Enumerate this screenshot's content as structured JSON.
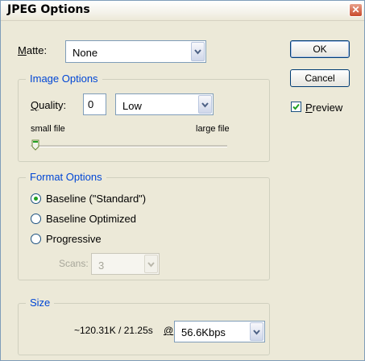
{
  "window": {
    "title": "JPEG Options"
  },
  "matte": {
    "label_prefix": "",
    "label_u": "M",
    "label_rest": "atte:",
    "value": "None"
  },
  "buttons": {
    "ok": "OK",
    "cancel": "Cancel"
  },
  "preview": {
    "checked": true,
    "label_u": "P",
    "label_rest": "review"
  },
  "image_options": {
    "legend": "Image Options",
    "quality_label_u": "Q",
    "quality_label_rest": "uality:",
    "quality_value": "0",
    "quality_preset": "Low",
    "small_file": "small file",
    "large_file": "large file",
    "slider_level": 0
  },
  "format_options": {
    "legend": "Format Options",
    "options": [
      {
        "label": "Baseline (\"Standard\")",
        "selected": true
      },
      {
        "label": "Baseline Optimized",
        "selected": false
      },
      {
        "label": "Progressive",
        "selected": false
      }
    ],
    "scans_label": "Scans:",
    "scans_value": "3"
  },
  "size": {
    "legend": "Size",
    "estimate": "~120.31K / 21.25s",
    "at_symbol": "@",
    "speed": "56.6Kbps"
  }
}
